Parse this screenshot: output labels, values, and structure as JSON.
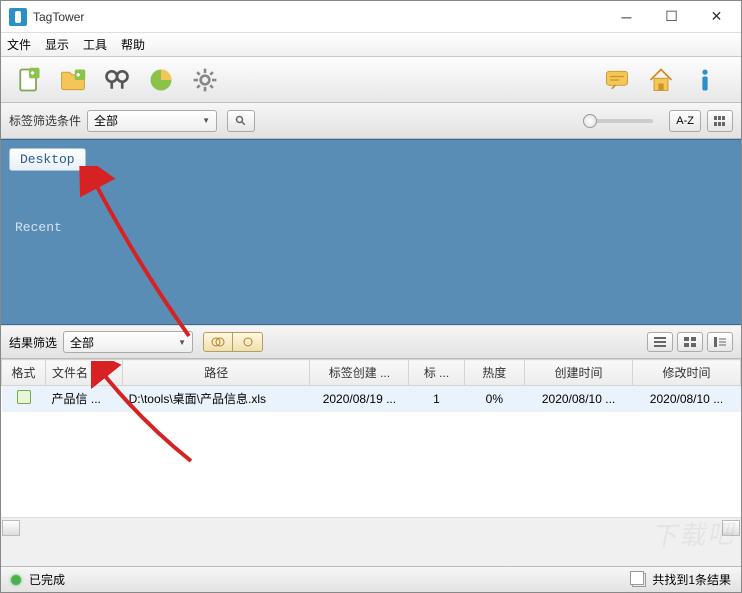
{
  "titlebar": {
    "title": "TagTower"
  },
  "menu": {
    "file": "文件",
    "view": "显示",
    "tools": "工具",
    "help": "帮助"
  },
  "filter": {
    "label": "标签筛选条件",
    "value": "全部",
    "sort_label": "A-Z"
  },
  "tags": {
    "desktop": "Desktop",
    "recent": "Recent"
  },
  "results_filter": {
    "label": "结果筛选",
    "value": "全部"
  },
  "table": {
    "headers": {
      "format": "格式",
      "filename": "文件名",
      "path": "路径",
      "tag_created": "标签创建 ...",
      "tags": "标 ...",
      "heat": "热度",
      "created": "创建时间",
      "modified": "修改时间"
    },
    "rows": [
      {
        "filename": "产品信 ...",
        "path": "D:\\tools\\桌面\\产品信息.xls",
        "tag_created": "2020/08/19 ...",
        "tags": "1",
        "heat": "0%",
        "created": "2020/08/10 ...",
        "modified": "2020/08/10 ..."
      }
    ]
  },
  "status": {
    "done": "已完成",
    "count": "共找到1条结果"
  }
}
